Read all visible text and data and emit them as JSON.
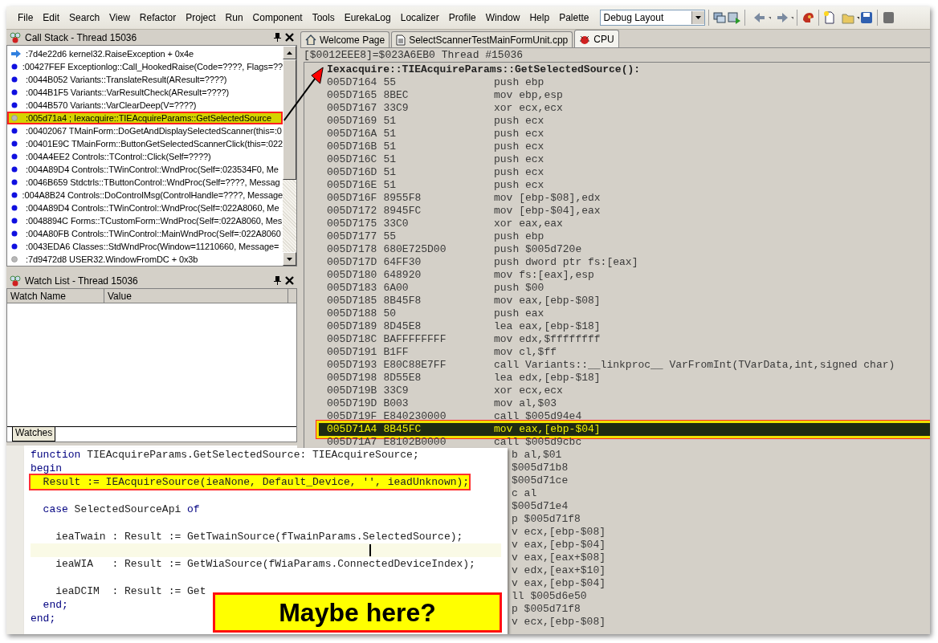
{
  "menu": [
    "File",
    "Edit",
    "Search",
    "View",
    "Refactor",
    "Project",
    "Run",
    "Component",
    "Tools",
    "EurekaLog",
    "Localizer",
    "Profile",
    "Window",
    "Help",
    "Palette"
  ],
  "toolbar": {
    "layout_combo": {
      "value": "Debug Layout"
    }
  },
  "call_stack": {
    "title": "Call Stack - Thread 15036",
    "items": [
      {
        "kind": "current",
        "text": ":7d4e22d6 kernel32.RaiseException + 0x4e",
        "selected": false
      },
      {
        "kind": "dot",
        "text": ":00427FEF Exceptionlog::Call_HookedRaise(Code=????, Flags=??",
        "selected": false
      },
      {
        "kind": "dot",
        "text": ":0044B052 Variants::TranslateResult(AResult=????)",
        "selected": false
      },
      {
        "kind": "dot",
        "text": ":0044B1F5 Variants::VarResultCheck(AResult=????)",
        "selected": false
      },
      {
        "kind": "dot",
        "text": ":0044B570 Variants::VarClearDeep(V=????)",
        "selected": false
      },
      {
        "kind": "nodebug",
        "text": ":005d71a4 ; Iexacquire::TIEAcquireParams::GetSelectedSource",
        "selected": true
      },
      {
        "kind": "dot",
        "text": ":00402067 TMainForm::DoGetAndDisplaySelectedScanner(this=:0",
        "selected": false
      },
      {
        "kind": "dot",
        "text": ":00401E9C TMainForm::ButtonGetSelectedScannerClick(this=:022",
        "selected": false
      },
      {
        "kind": "dot",
        "text": ":004A4EE2 Controls::TControl::Click(Self=????)",
        "selected": false
      },
      {
        "kind": "dot",
        "text": ":004A89D4 Controls::TWinControl::WndProc(Self=:023534F0, Me",
        "selected": false
      },
      {
        "kind": "dot",
        "text": ":0046B659 Stdctrls::TButtonControl::WndProc(Self=????, Messag",
        "selected": false
      },
      {
        "kind": "dot",
        "text": ":004A8B24 Controls::DoControlMsg(ControlHandle=????, Message",
        "selected": false
      },
      {
        "kind": "dot",
        "text": ":004A89D4 Controls::TWinControl::WndProc(Self=:022A8060, Me",
        "selected": false
      },
      {
        "kind": "dot",
        "text": ":0048894C Forms::TCustomForm::WndProc(Self=:022A8060, Mes",
        "selected": false
      },
      {
        "kind": "dot",
        "text": ":004A80FB Controls::TWinControl::MainWndProc(Self=:022A8060",
        "selected": false
      },
      {
        "kind": "dot",
        "text": ":0043EDA6 Classes::StdWndProc(Window=11210660, Message=",
        "selected": false
      },
      {
        "kind": "nodebug",
        "text": ":7d9472d8 USER32.WindowFromDC + 0x3b",
        "selected": false
      }
    ]
  },
  "watch_list": {
    "title": "Watch List - Thread 15036",
    "columns": [
      "Watch Name",
      "Value"
    ],
    "tabs": [
      {
        "label": "Watches",
        "selected": true
      }
    ]
  },
  "editor_tabs": [
    {
      "label": "Welcome Page",
      "selected": false
    },
    {
      "label": "SelectScannerTestMainFormUnit.cpp",
      "selected": false
    },
    {
      "label": "CPU",
      "selected": true
    }
  ],
  "cpu": {
    "status": "[$0012EEE8]=$023A6EB0 Thread #15036",
    "procedure": "Iexacquire::TIEAcquireParams::GetSelectedSource():",
    "rows": [
      {
        "kind": "full",
        "address": "005D7164",
        "bytes": "55",
        "instruction": "push ebp",
        "selected": false
      },
      {
        "kind": "full",
        "address": "005D7165",
        "bytes": "8BEC",
        "instruction": "mov ebp,esp",
        "selected": false
      },
      {
        "kind": "full",
        "address": "005D7167",
        "bytes": "33C9",
        "instruction": "xor ecx,ecx",
        "selected": false
      },
      {
        "kind": "full",
        "address": "005D7169",
        "bytes": "51",
        "instruction": "push ecx",
        "selected": false
      },
      {
        "kind": "full",
        "address": "005D716A",
        "bytes": "51",
        "instruction": "push ecx",
        "selected": false
      },
      {
        "kind": "full",
        "address": "005D716B",
        "bytes": "51",
        "instruction": "push ecx",
        "selected": false
      },
      {
        "kind": "full",
        "address": "005D716C",
        "bytes": "51",
        "instruction": "push ecx",
        "selected": false
      },
      {
        "kind": "full",
        "address": "005D716D",
        "bytes": "51",
        "instruction": "push ecx",
        "selected": false
      },
      {
        "kind": "full",
        "address": "005D716E",
        "bytes": "51",
        "instruction": "push ecx",
        "selected": false
      },
      {
        "kind": "full",
        "address": "005D716F",
        "bytes": "8955F8",
        "instruction": "mov [ebp-$08],edx",
        "selected": false
      },
      {
        "kind": "full",
        "address": "005D7172",
        "bytes": "8945FC",
        "instruction": "mov [ebp-$04],eax",
        "selected": false
      },
      {
        "kind": "full",
        "address": "005D7175",
        "bytes": "33C0",
        "instruction": "xor eax,eax",
        "selected": false
      },
      {
        "kind": "full",
        "address": "005D7177",
        "bytes": "55",
        "instruction": "push ebp",
        "selected": false
      },
      {
        "kind": "full",
        "address": "005D7178",
        "bytes": "680E725D00",
        "instruction": "push $005d720e",
        "selected": false
      },
      {
        "kind": "full",
        "address": "005D717D",
        "bytes": "64FF30",
        "instruction": "push dword ptr fs:[eax]",
        "selected": false
      },
      {
        "kind": "full",
        "address": "005D7180",
        "bytes": "648920",
        "instruction": "mov fs:[eax],esp",
        "selected": false
      },
      {
        "kind": "full",
        "address": "005D7183",
        "bytes": "6A00",
        "instruction": "push $00",
        "selected": false
      },
      {
        "kind": "full",
        "address": "005D7185",
        "bytes": "8B45F8",
        "instruction": "mov eax,[ebp-$08]",
        "selected": false
      },
      {
        "kind": "full",
        "address": "005D7188",
        "bytes": "50",
        "instruction": "push eax",
        "selected": false
      },
      {
        "kind": "full",
        "address": "005D7189",
        "bytes": "8D45E8",
        "instruction": "lea eax,[ebp-$18]",
        "selected": false
      },
      {
        "kind": "full",
        "address": "005D718C",
        "bytes": "BAFFFFFFFF",
        "instruction": "mov edx,$ffffffff",
        "selected": false
      },
      {
        "kind": "full",
        "address": "005D7191",
        "bytes": "B1FF",
        "instruction": "mov cl,$ff",
        "selected": false
      },
      {
        "kind": "full",
        "address": "005D7193",
        "bytes": "E80C88E7FF",
        "instruction": "call Variants::__linkproc__ VarFromInt(TVarData,int,signed char)",
        "selected": false
      },
      {
        "kind": "full",
        "address": "005D7198",
        "bytes": "8D55E8",
        "instruction": "lea edx,[ebp-$18]",
        "selected": false
      },
      {
        "kind": "full",
        "address": "005D719B",
        "bytes": "33C9",
        "instruction": "xor ecx,ecx",
        "selected": false
      },
      {
        "kind": "full",
        "address": "005D719D",
        "bytes": "B003",
        "instruction": "mov al,$03",
        "selected": false
      },
      {
        "kind": "full",
        "address": "005D719F",
        "bytes": "E840230000",
        "instruction": "call $005d94e4",
        "selected": false
      },
      {
        "kind": "full",
        "address": "005D71A4",
        "bytes": "8B45FC",
        "instruction": "mov eax,[ebp-$04]",
        "selected": true
      },
      {
        "kind": "full",
        "address": "005D71A7",
        "bytes": "E8102B0000",
        "instruction": "call $005d9cbc",
        "selected": false
      },
      {
        "kind": "partial",
        "instruction": "b al,$01",
        "selected": false
      },
      {
        "kind": "partial",
        "instruction": "$005d71b8",
        "selected": false
      },
      {
        "kind": "partial",
        "instruction": "$005d71ce",
        "selected": false
      },
      {
        "kind": "partial",
        "instruction": "c al",
        "selected": false
      },
      {
        "kind": "partial",
        "instruction": "$005d71e4",
        "selected": false
      },
      {
        "kind": "partial",
        "instruction": "p $005d71f8",
        "selected": false
      },
      {
        "kind": "partial",
        "instruction": "v ecx,[ebp-$08]",
        "selected": false
      },
      {
        "kind": "partial",
        "instruction": "v eax,[ebp-$04]",
        "selected": false
      },
      {
        "kind": "partial",
        "instruction": "v eax,[eax+$08]",
        "selected": false
      },
      {
        "kind": "partial",
        "instruction": "v edx,[eax+$10]",
        "selected": false
      },
      {
        "kind": "partial",
        "instruction": "v eax,[ebp-$04]",
        "selected": false
      },
      {
        "kind": "partial",
        "instruction": "ll $005d6e50",
        "selected": false
      },
      {
        "kind": "partial",
        "instruction": "p $005d71f8",
        "selected": false
      },
      {
        "kind": "partial",
        "instruction": "v ecx,[ebp-$08]",
        "selected": false
      }
    ]
  },
  "code_popup": {
    "lines": [
      {
        "kind": "code",
        "highlighted": false,
        "segments": [
          {
            "text": "function",
            "keyword": true
          },
          {
            "text": " TIEAcquireParams.GetSelectedSource: TIEAcquireSource;",
            "keyword": false
          }
        ]
      },
      {
        "kind": "code",
        "highlighted": false,
        "segments": [
          {
            "text": "begin",
            "keyword": true
          }
        ]
      },
      {
        "kind": "code",
        "highlighted": true,
        "segments": [
          {
            "text": "  Result := IEAcquireSource(ieaNone, Default_Device, '', ieadUnknown);",
            "keyword": false
          }
        ]
      },
      {
        "kind": "blank"
      },
      {
        "kind": "code",
        "highlighted": false,
        "segments": [
          {
            "text": "  case",
            "keyword": true
          },
          {
            "text": " SelectedSourceApi ",
            "keyword": false
          },
          {
            "text": "of",
            "keyword": true
          }
        ]
      },
      {
        "kind": "blank"
      },
      {
        "kind": "code",
        "highlighted": false,
        "segments": [
          {
            "text": "    ieaTwain : Result := GetTwainSource(fTwainParams.SelectedSource);",
            "keyword": false
          }
        ]
      },
      {
        "kind": "current"
      },
      {
        "kind": "code",
        "highlighted": false,
        "segments": [
          {
            "text": "    ieaWIA   : Result := GetWiaSource(fWiaParams.ConnectedDeviceIndex);",
            "keyword": false
          }
        ]
      },
      {
        "kind": "blank"
      },
      {
        "kind": "code",
        "highlighted": false,
        "segments": [
          {
            "text": "    ieaDCIM  : Result := Get",
            "keyword": false
          }
        ]
      },
      {
        "kind": "code",
        "highlighted": false,
        "segments": [
          {
            "text": "  end;",
            "keyword": true
          }
        ]
      },
      {
        "kind": "code",
        "highlighted": false,
        "segments": [
          {
            "text": "end;",
            "keyword": true
          }
        ]
      }
    ],
    "callout": "Maybe here?"
  }
}
